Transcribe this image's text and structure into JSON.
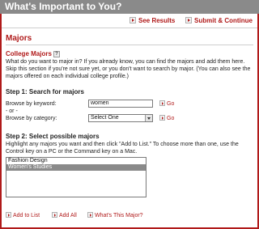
{
  "header": {
    "title": "What's Important to You?",
    "see_results": "See Results",
    "submit_continue": "Submit & Continue"
  },
  "section": {
    "title": "Majors",
    "subtitle": "College Majors",
    "help_glyph": "?",
    "intro": "What do you want to major in? If you already know, you can find the majors and add them here. Skip this section if you're not sure yet, or you don't want to search by major. (You can also see the majors offered on each individual college profile.)"
  },
  "step1": {
    "title": "Step 1: Search for majors",
    "keyword_label": "Browse by keyword:",
    "keyword_value": "women",
    "or_text": "- or -",
    "category_label": "Browse by category:",
    "category_value": "Select One",
    "go_label": "Go"
  },
  "step2": {
    "title": "Step 2: Select possible majors",
    "instructions": "Highlight any majors you want and then click \"Add to List.\" To choose more than one, use the Control key on a PC or the Command key on a Mac.",
    "options": [
      {
        "label": "Fashion Design",
        "selected": false
      },
      {
        "label": "Women's Studies",
        "selected": true
      }
    ]
  },
  "actions": {
    "add_to_list": "Add to List",
    "add_all": "Add All",
    "whats_this": "What's This Major?"
  },
  "colors": {
    "accent": "#b01a1a",
    "titlebar": "#8a8a8a",
    "selected_bg": "#8a8a8a"
  }
}
